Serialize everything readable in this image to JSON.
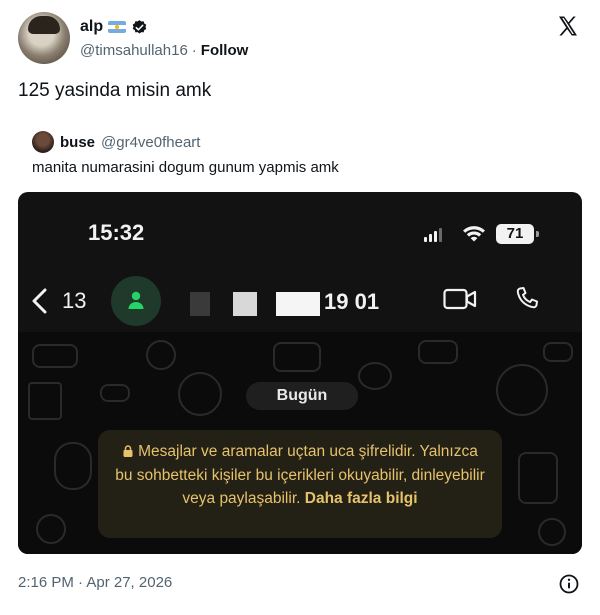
{
  "author": {
    "display_name": "alp",
    "handle": "@timsahullah16",
    "separator": "·",
    "follow_label": "Follow",
    "flag_icon": "argentina-flag-icon",
    "verified_icon": "verified-badge-icon"
  },
  "tweet": {
    "text": "125 yasinda misin amk"
  },
  "quote": {
    "name": "buse",
    "handle": "@gr4ve0fheart",
    "text": "manita numarasini dogum gunum yapmis amk"
  },
  "phone": {
    "status_time": "15:32",
    "battery": "71",
    "back_count": "13",
    "contact_suffix": "19 01",
    "date_pill": "Bugün",
    "encryption_text": "Mesajlar ve aramalar uçtan uca şifrelidir. Yalnızca bu sohbetteki kişiler bu içerikleri okuyabilir, dinleyebilir veya paylaşabilir.",
    "encryption_link": "Daha fazla bilgi"
  },
  "footer": {
    "timestamp": "2:16 PM · Apr 27, 2026"
  },
  "colors": {
    "text_primary": "#0f1419",
    "text_secondary": "#536471",
    "whatsapp_green": "#25d366",
    "encryption_gold": "#e6c26a"
  }
}
